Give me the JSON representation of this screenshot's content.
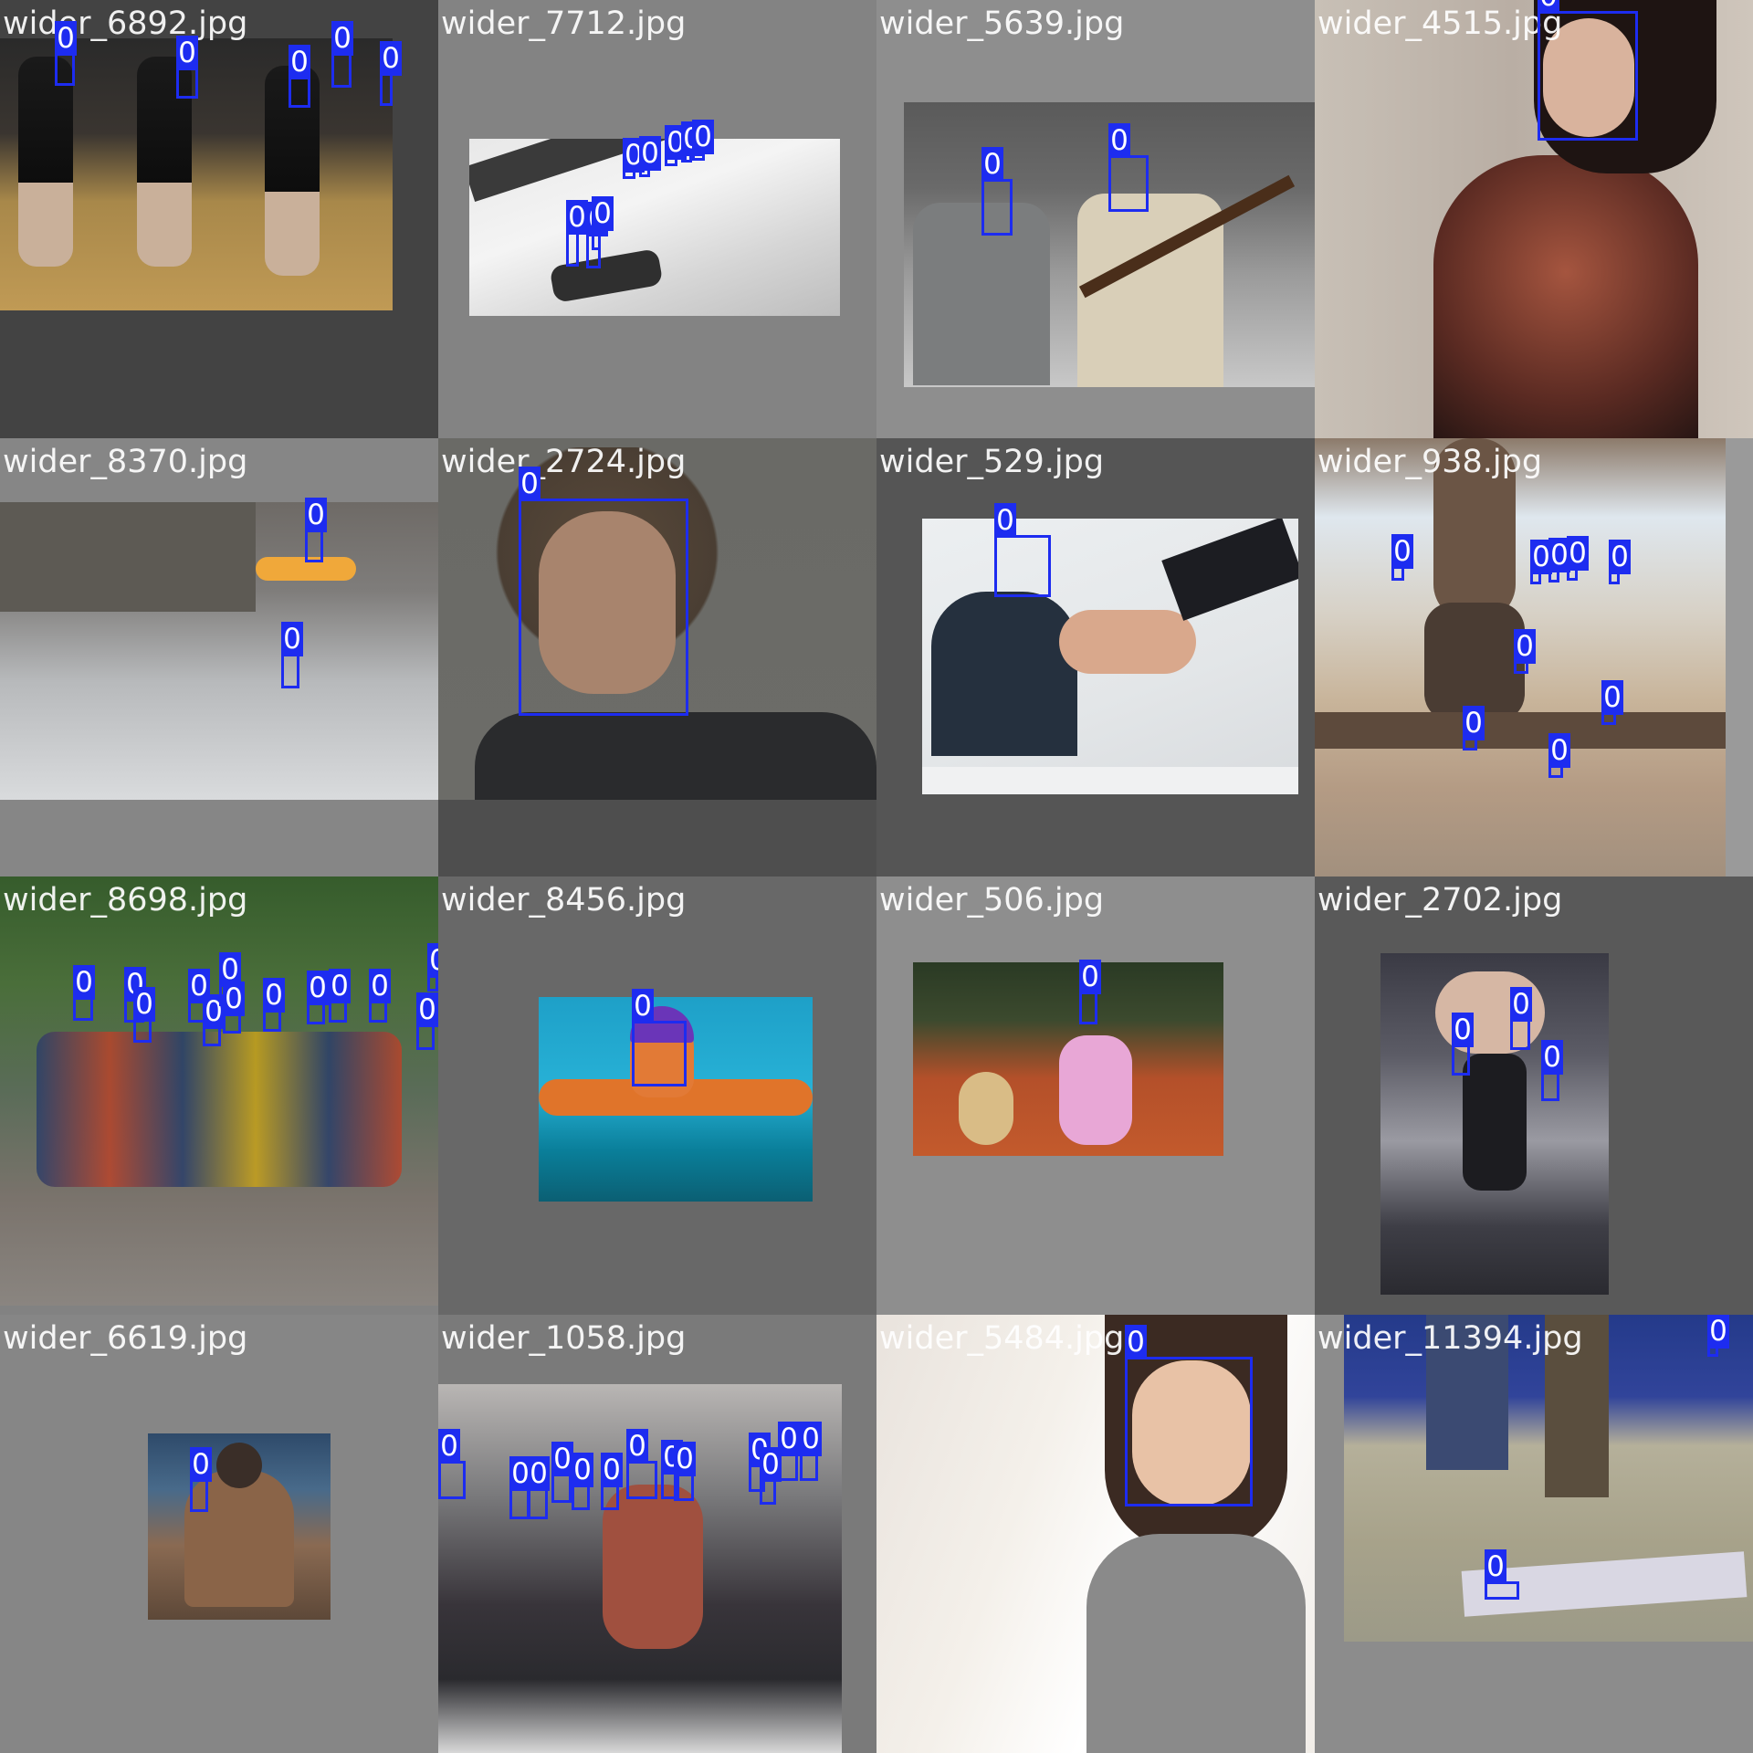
{
  "mosaic": {
    "class_label": "0",
    "box_color": "#1d2cf0",
    "tiles": [
      {
        "filename": "wider_6892.jpg",
        "scene": "cheerleaders-on-court",
        "faces": 5
      },
      {
        "filename": "wider_7712.jpg",
        "scene": "parachute-jump-bw",
        "faces": 8
      },
      {
        "filename": "wider_5639.jpg",
        "scene": "street-crowd-rifle",
        "faces": 2
      },
      {
        "filename": "wider_4515.jpg",
        "scene": "woman-portrait",
        "faces": 1
      },
      {
        "filename": "wider_8370.jpg",
        "scene": "river-kayak",
        "faces": 2
      },
      {
        "filename": "wider_2724.jpg",
        "scene": "man-portrait",
        "faces": 1
      },
      {
        "filename": "wider_529.jpg",
        "scene": "handshake-stock",
        "faces": 1
      },
      {
        "filename": "wider_938.jpg",
        "scene": "mud-run",
        "faces": 10
      },
      {
        "filename": "wider_8698.jpg",
        "scene": "kayak-group",
        "faces": 17
      },
      {
        "filename": "wider_8456.jpg",
        "scene": "swimmer-butterfly",
        "faces": 1
      },
      {
        "filename": "wider_506.jpg",
        "scene": "girl-with-dog",
        "faces": 1
      },
      {
        "filename": "wider_2702.jpg",
        "scene": "concert-performer",
        "faces": 3
      },
      {
        "filename": "wider_6619.jpg",
        "scene": "tattoo-back",
        "faces": 1
      },
      {
        "filename": "wider_1058.jpg",
        "scene": "snow-festival-crowd",
        "faces": 13
      },
      {
        "filename": "wider_5484.jpg",
        "scene": "child-headphones",
        "faces": 1
      },
      {
        "filename": "wider_11394.jpg",
        "scene": "street-feet-flyer",
        "faces": 2
      }
    ]
  }
}
